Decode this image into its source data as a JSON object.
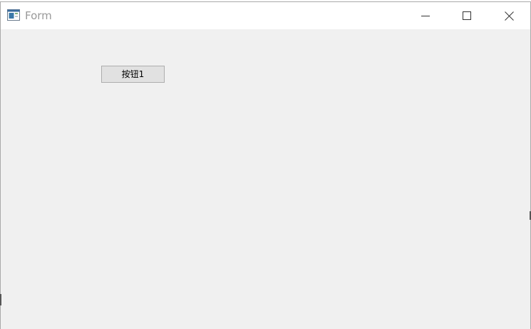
{
  "window": {
    "title": "Form",
    "app_icon": "form-window-icon",
    "controls": {
      "minimize_icon": "minimize-icon",
      "maximize_icon": "maximize-icon",
      "close_icon": "close-icon"
    }
  },
  "form": {
    "button1_label": "按钮1"
  },
  "colors": {
    "titlebar": "#ffffff",
    "client_background": "#f0f0f0",
    "button_face": "#e1e1e1",
    "button_border": "#adadad",
    "title_text": "#999999"
  }
}
